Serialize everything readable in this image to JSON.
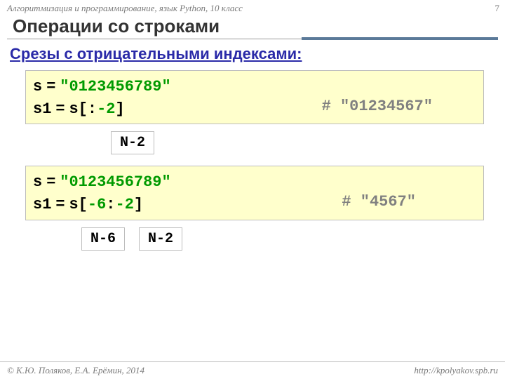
{
  "header": {
    "sub": "Алгоритмизация и программирование, язык Python, 10 класс",
    "page": "7",
    "title": "Операции со строками"
  },
  "subtitle": "Срезы с отрицательными индексами:",
  "block1": {
    "l1a": "s",
    "l1b": " = ",
    "l1c": "\"0123456789\"",
    "l2a": "s1",
    "l2b": " = ",
    "l2c": "s[:",
    "l2d": "-2",
    "l2e": "]",
    "comment": "#  \"01234567\"",
    "label": "N-2"
  },
  "block2": {
    "l1a": "s",
    "l1b": " = ",
    "l1c": "\"0123456789\"",
    "l2a": "s1",
    "l2b": " = ",
    "l2c": "s[",
    "l2d1": "-6",
    "l2e": ":",
    "l2d2": "-2",
    "l2f": "]",
    "comment": "#  \"4567\"",
    "label1": "N-6",
    "label2": "N-2"
  },
  "footer": {
    "left": "© К.Ю. Поляков, Е.А. Ерёмин, 2014",
    "right": "http://kpolyakov.spb.ru"
  }
}
